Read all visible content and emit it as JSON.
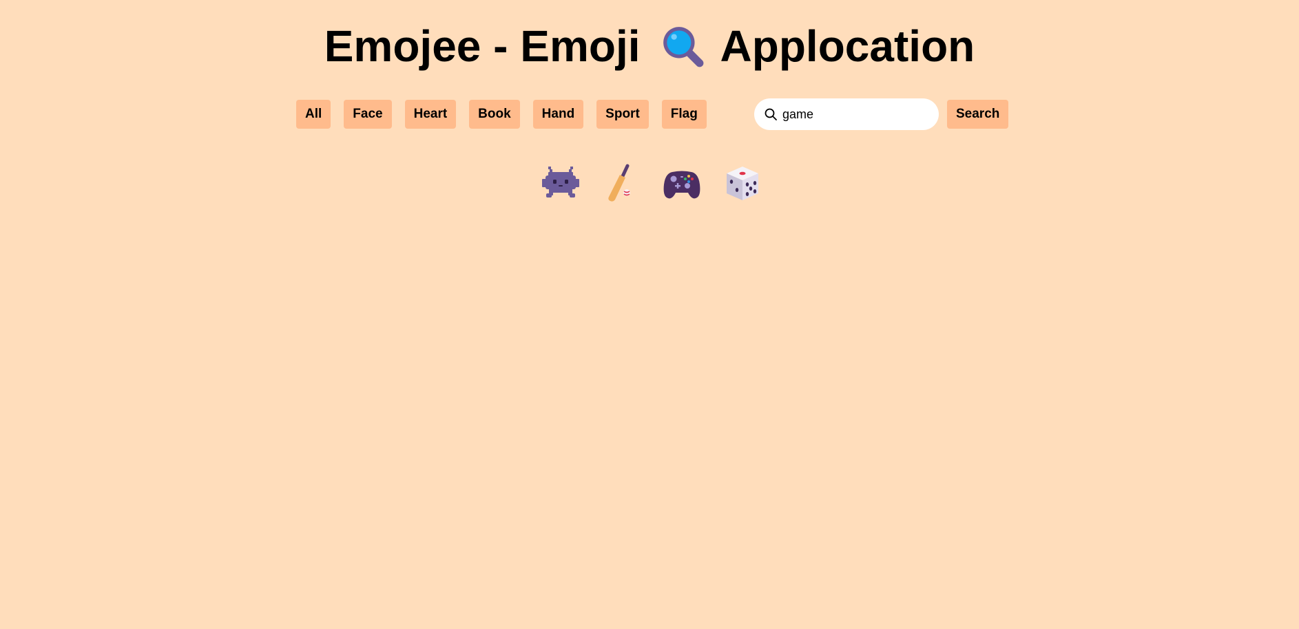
{
  "header": {
    "title_part1": "Emojee - Emoji",
    "title_part2": "Applocation",
    "title_icon": "magnifying-glass-icon"
  },
  "categories": [
    "All",
    "Face",
    "Heart",
    "Book",
    "Hand",
    "Sport",
    "Flag"
  ],
  "search": {
    "value": "game",
    "icon": "search-icon",
    "button_label": "Search"
  },
  "results": [
    {
      "name": "alien-monster-icon"
    },
    {
      "name": "cricket-bat-icon"
    },
    {
      "name": "video-game-controller-icon"
    },
    {
      "name": "game-die-icon"
    }
  ],
  "colors": {
    "background": "#FFDDBB",
    "button": "#FFBB8C",
    "emoji_purple": "#6B5B9A"
  }
}
